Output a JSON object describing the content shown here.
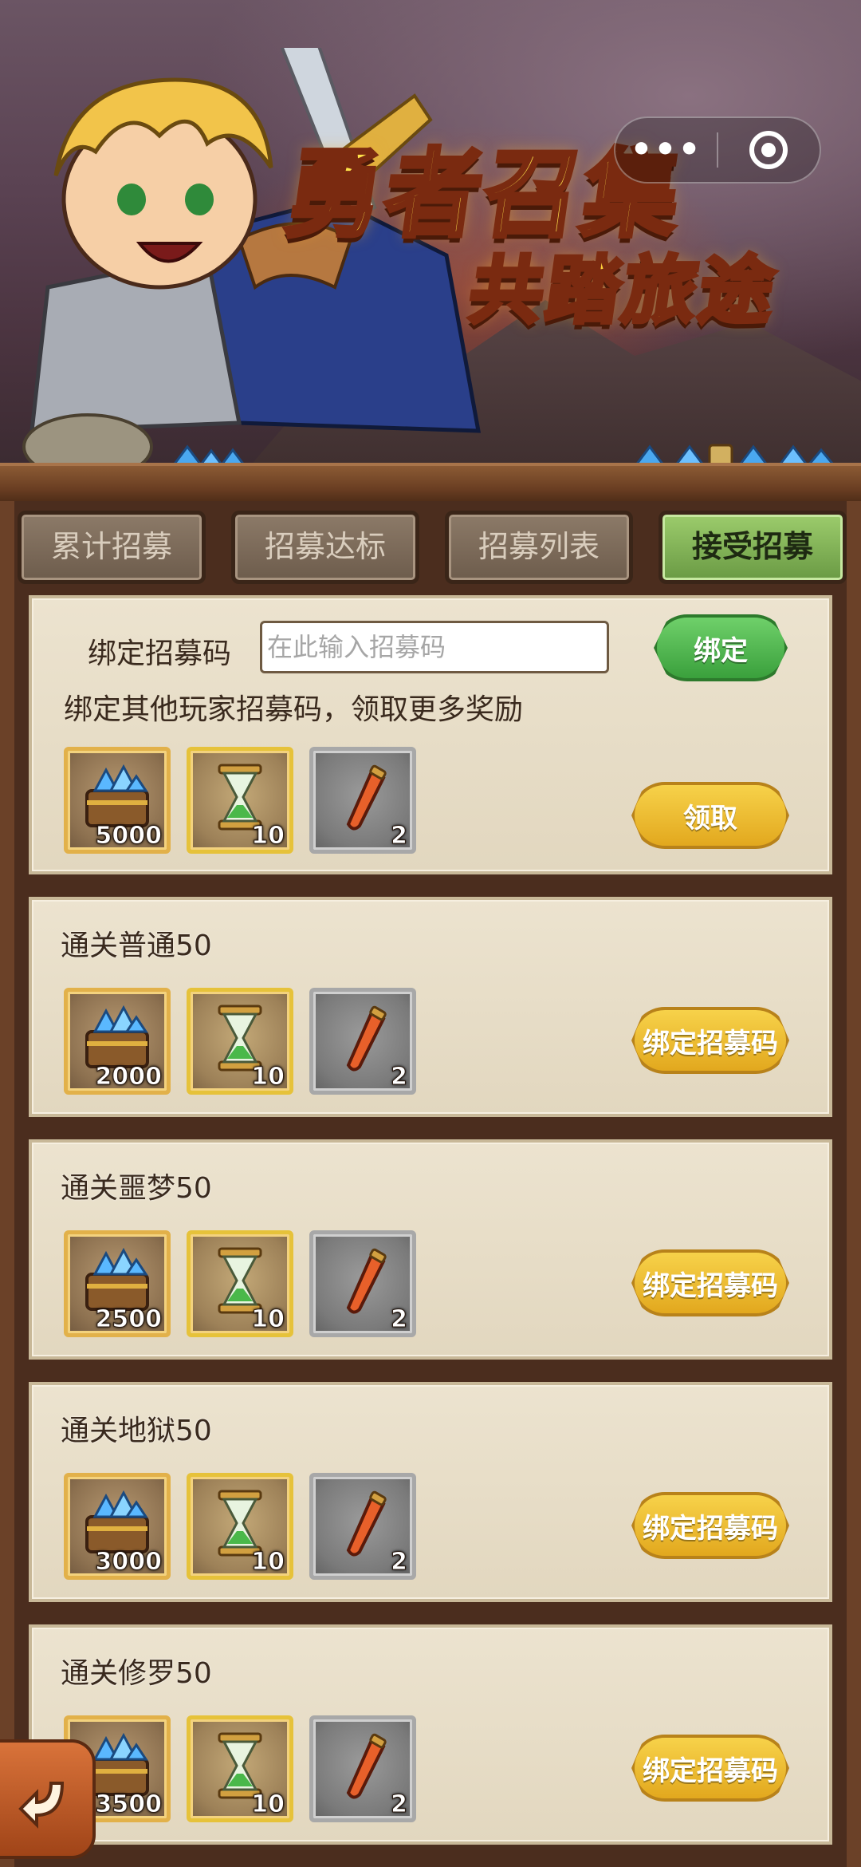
{
  "banner": {
    "title_line1": "勇者召集",
    "title_line2": "共踏旅途"
  },
  "capsule": {
    "more_label": "•••"
  },
  "tabs": [
    {
      "label": "累计招募",
      "active": false
    },
    {
      "label": "招募达标",
      "active": false
    },
    {
      "label": "招募列表",
      "active": false
    },
    {
      "label": "接受招募",
      "active": true
    }
  ],
  "bind_card": {
    "label": "绑定招募码",
    "input_placeholder": "在此输入招募码",
    "input_value": "",
    "bind_button": "绑定",
    "description": "绑定其他玩家招募码，领取更多奖励",
    "claim_button": "领取",
    "rewards": [
      {
        "icon": "diamond-chest-icon",
        "count": "5000"
      },
      {
        "icon": "hourglass-icon",
        "count": "10"
      },
      {
        "icon": "potion-icon",
        "count": "2"
      }
    ]
  },
  "tasks": [
    {
      "title": "通关普通50",
      "button": "绑定招募码",
      "rewards": [
        {
          "icon": "diamond-chest-icon",
          "count": "2000"
        },
        {
          "icon": "hourglass-icon",
          "count": "10"
        },
        {
          "icon": "potion-icon",
          "count": "2"
        }
      ]
    },
    {
      "title": "通关噩梦50",
      "button": "绑定招募码",
      "rewards": [
        {
          "icon": "diamond-chest-icon",
          "count": "2500"
        },
        {
          "icon": "hourglass-icon",
          "count": "10"
        },
        {
          "icon": "potion-icon",
          "count": "2"
        }
      ]
    },
    {
      "title": "通关地狱50",
      "button": "绑定招募码",
      "rewards": [
        {
          "icon": "diamond-chest-icon",
          "count": "3000"
        },
        {
          "icon": "hourglass-icon",
          "count": "10"
        },
        {
          "icon": "potion-icon",
          "count": "2"
        }
      ]
    },
    {
      "title": "通关修罗50",
      "button": "绑定招募码",
      "rewards": [
        {
          "icon": "diamond-chest-icon",
          "count": "3500"
        },
        {
          "icon": "hourglass-icon",
          "count": "10"
        },
        {
          "icon": "potion-icon",
          "count": "2"
        }
      ]
    }
  ],
  "colors": {
    "active_tab": "#7fb456",
    "bind_button": "#4cb04a",
    "action_button": "#ecbc32",
    "title_gold": "#ffe34a"
  }
}
